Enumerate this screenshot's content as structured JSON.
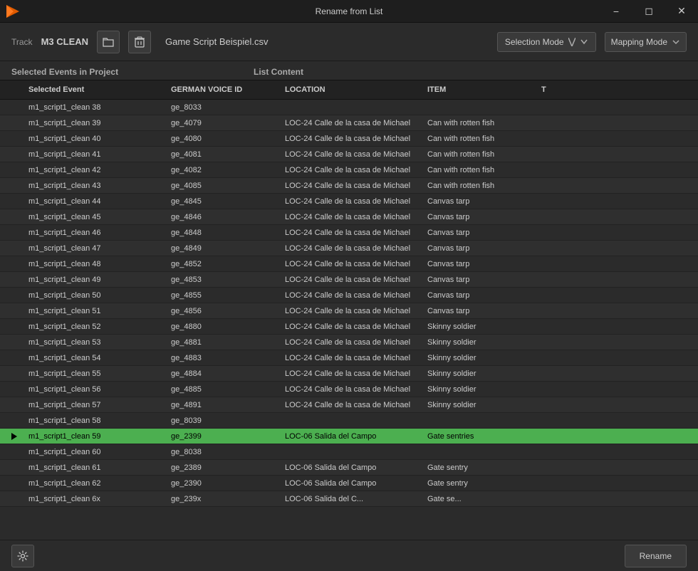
{
  "window": {
    "title": "Rename from List"
  },
  "toolbar": {
    "track_label": "Track",
    "track_value": "M3 CLEAN",
    "filename": "Game Script Beispiel.csv",
    "selection_mode": "Selection Mode",
    "mapping_mode": "Mapping Mode"
  },
  "sections": {
    "left_header": "Selected Events in Project",
    "right_header": "List Content"
  },
  "columns": {
    "event": "Selected Event",
    "voice": "GERMAN VOICE ID",
    "location": "LOCATION",
    "item": "ITEM",
    "t": "T"
  },
  "rows": [
    {
      "id": 0,
      "play": false,
      "event": "m1_script1_clean 38",
      "voice": "ge_8033",
      "location": "",
      "item": "",
      "highlighted": false
    },
    {
      "id": 1,
      "play": false,
      "event": "m1_script1_clean 39",
      "voice": "ge_4079",
      "location": "LOC-24 Calle de la casa de Michael",
      "item": "Can with rotten fish",
      "highlighted": false
    },
    {
      "id": 2,
      "play": false,
      "event": "m1_script1_clean 40",
      "voice": "ge_4080",
      "location": "LOC-24 Calle de la casa de Michael",
      "item": "Can with rotten fish",
      "highlighted": false
    },
    {
      "id": 3,
      "play": false,
      "event": "m1_script1_clean 41",
      "voice": "ge_4081",
      "location": "LOC-24 Calle de la casa de Michael",
      "item": "Can with rotten fish",
      "highlighted": false
    },
    {
      "id": 4,
      "play": false,
      "event": "m1_script1_clean 42",
      "voice": "ge_4082",
      "location": "LOC-24 Calle de la casa de Michael",
      "item": "Can with rotten fish",
      "highlighted": false
    },
    {
      "id": 5,
      "play": false,
      "event": "m1_script1_clean 43",
      "voice": "ge_4085",
      "location": "LOC-24 Calle de la casa de Michael",
      "item": "Can with rotten fish",
      "highlighted": false
    },
    {
      "id": 6,
      "play": false,
      "event": "m1_script1_clean 44",
      "voice": "ge_4845",
      "location": "LOC-24 Calle de la casa de Michael",
      "item": "Canvas tarp",
      "highlighted": false
    },
    {
      "id": 7,
      "play": false,
      "event": "m1_script1_clean 45",
      "voice": "ge_4846",
      "location": "LOC-24 Calle de la casa de Michael",
      "item": "Canvas tarp",
      "highlighted": false
    },
    {
      "id": 8,
      "play": false,
      "event": "m1_script1_clean 46",
      "voice": "ge_4848",
      "location": "LOC-24 Calle de la casa de Michael",
      "item": "Canvas tarp",
      "highlighted": false
    },
    {
      "id": 9,
      "play": false,
      "event": "m1_script1_clean 47",
      "voice": "ge_4849",
      "location": "LOC-24 Calle de la casa de Michael",
      "item": "Canvas tarp",
      "highlighted": false
    },
    {
      "id": 10,
      "play": false,
      "event": "m1_script1_clean 48",
      "voice": "ge_4852",
      "location": "LOC-24 Calle de la casa de Michael",
      "item": "Canvas tarp",
      "highlighted": false
    },
    {
      "id": 11,
      "play": false,
      "event": "m1_script1_clean 49",
      "voice": "ge_4853",
      "location": "LOC-24 Calle de la casa de Michael",
      "item": "Canvas tarp",
      "highlighted": false
    },
    {
      "id": 12,
      "play": false,
      "event": "m1_script1_clean 50",
      "voice": "ge_4855",
      "location": "LOC-24 Calle de la casa de Michael",
      "item": "Canvas tarp",
      "highlighted": false
    },
    {
      "id": 13,
      "play": false,
      "event": "m1_script1_clean 51",
      "voice": "ge_4856",
      "location": "LOC-24 Calle de la casa de Michael",
      "item": "Canvas tarp",
      "highlighted": false
    },
    {
      "id": 14,
      "play": false,
      "event": "m1_script1_clean 52",
      "voice": "ge_4880",
      "location": "LOC-24 Calle de la casa de Michael",
      "item": "Skinny soldier",
      "highlighted": false
    },
    {
      "id": 15,
      "play": false,
      "event": "m1_script1_clean 53",
      "voice": "ge_4881",
      "location": "LOC-24 Calle de la casa de Michael",
      "item": "Skinny soldier",
      "highlighted": false
    },
    {
      "id": 16,
      "play": false,
      "event": "m1_script1_clean 54",
      "voice": "ge_4883",
      "location": "LOC-24 Calle de la casa de Michael",
      "item": "Skinny soldier",
      "highlighted": false
    },
    {
      "id": 17,
      "play": false,
      "event": "m1_script1_clean 55",
      "voice": "ge_4884",
      "location": "LOC-24 Calle de la casa de Michael",
      "item": "Skinny soldier",
      "highlighted": false
    },
    {
      "id": 18,
      "play": false,
      "event": "m1_script1_clean 56",
      "voice": "ge_4885",
      "location": "LOC-24 Calle de la casa de Michael",
      "item": "Skinny soldier",
      "highlighted": false
    },
    {
      "id": 19,
      "play": false,
      "event": "m1_script1_clean 57",
      "voice": "ge_4891",
      "location": "LOC-24 Calle de la casa de Michael",
      "item": "Skinny soldier",
      "highlighted": false
    },
    {
      "id": 20,
      "play": false,
      "event": "m1_script1_clean 58",
      "voice": "ge_8039",
      "location": "",
      "item": "",
      "highlighted": false
    },
    {
      "id": 21,
      "play": true,
      "event": "m1_script1_clean 59",
      "voice": "ge_2399",
      "location": "LOC-06 Salida del Campo",
      "item": "Gate sentries",
      "highlighted": true
    },
    {
      "id": 22,
      "play": false,
      "event": "m1_script1_clean 60",
      "voice": "ge_8038",
      "location": "",
      "item": "",
      "highlighted": false
    },
    {
      "id": 23,
      "play": false,
      "event": "m1_script1_clean 61",
      "voice": "ge_2389",
      "location": "LOC-06 Salida del Campo",
      "item": "Gate sentry",
      "highlighted": false
    },
    {
      "id": 24,
      "play": false,
      "event": "m1_script1_clean 62",
      "voice": "ge_2390",
      "location": "LOC-06 Salida del Campo",
      "item": "Gate sentry",
      "highlighted": false
    },
    {
      "id": 25,
      "play": false,
      "event": "m1_script1_clean 6x",
      "voice": "ge_239x",
      "location": "LOC-06 Salida del C...",
      "item": "Gate se...",
      "highlighted": false
    }
  ],
  "buttons": {
    "rename": "Rename",
    "settings": "⚙"
  }
}
